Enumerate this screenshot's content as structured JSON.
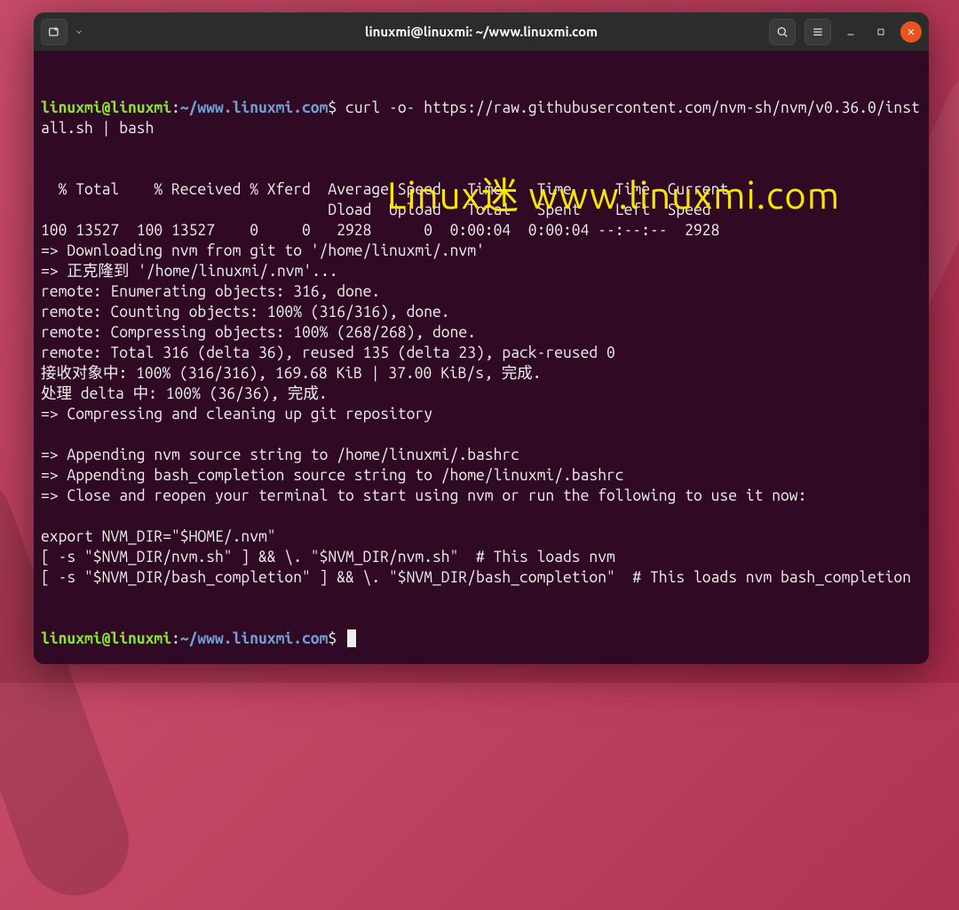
{
  "window": {
    "title": "linuxmi@linuxmi: ~/www.linuxmi.com"
  },
  "prompt": {
    "user": "linuxmi@linuxmi",
    "sep": ":",
    "path": "~/www.linuxmi.com",
    "symbol": "$"
  },
  "command": " curl -o- https://raw.githubusercontent.com/nvm-sh/nvm/v0.36.0/install.sh | bash",
  "output_lines": [
    "  % Total    % Received % Xferd  Average Speed   Time    Time     Time  Current",
    "                                 Dload  Upload   Total   Spent    Left  Speed",
    "100 13527  100 13527    0     0   2928      0  0:00:04  0:00:04 --:--:--  2928",
    "=> Downloading nvm from git to '/home/linuxmi/.nvm'",
    "=> 正克隆到 '/home/linuxmi/.nvm'...",
    "remote: Enumerating objects: 316, done.",
    "remote: Counting objects: 100% (316/316), done.",
    "remote: Compressing objects: 100% (268/268), done.",
    "remote: Total 316 (delta 36), reused 135 (delta 23), pack-reused 0",
    "接收对象中: 100% (316/316), 169.68 KiB | 37.00 KiB/s, 完成.",
    "处理 delta 中: 100% (36/36), 完成.",
    "=> Compressing and cleaning up git repository",
    "",
    "=> Appending nvm source string to /home/linuxmi/.bashrc",
    "=> Appending bash_completion source string to /home/linuxmi/.bashrc",
    "=> Close and reopen your terminal to start using nvm or run the following to use it now:",
    "",
    "export NVM_DIR=\"$HOME/.nvm\"",
    "[ -s \"$NVM_DIR/nvm.sh\" ] && \\. \"$NVM_DIR/nvm.sh\"  # This loads nvm",
    "[ -s \"$NVM_DIR/bash_completion\" ] && \\. \"$NVM_DIR/bash_completion\"  # This loads nvm bash_completion"
  ],
  "watermark": "Linux迷 www.linuxmi.com",
  "icons": {
    "new_tab": "new-tab-icon",
    "search": "search-icon",
    "menu": "hamburger-icon",
    "minimize": "minimize-icon",
    "maximize": "maximize-icon",
    "close": "close-icon",
    "caret": "chevron-down-icon"
  },
  "colors": {
    "terminal_bg": "#300a24",
    "titlebar_bg": "#2c2c2c",
    "user_fg": "#8ae234",
    "path_fg": "#729fcf",
    "text_fg": "#eeeeee",
    "close_btn": "#e95420",
    "watermark_fg": "#f9e600"
  }
}
